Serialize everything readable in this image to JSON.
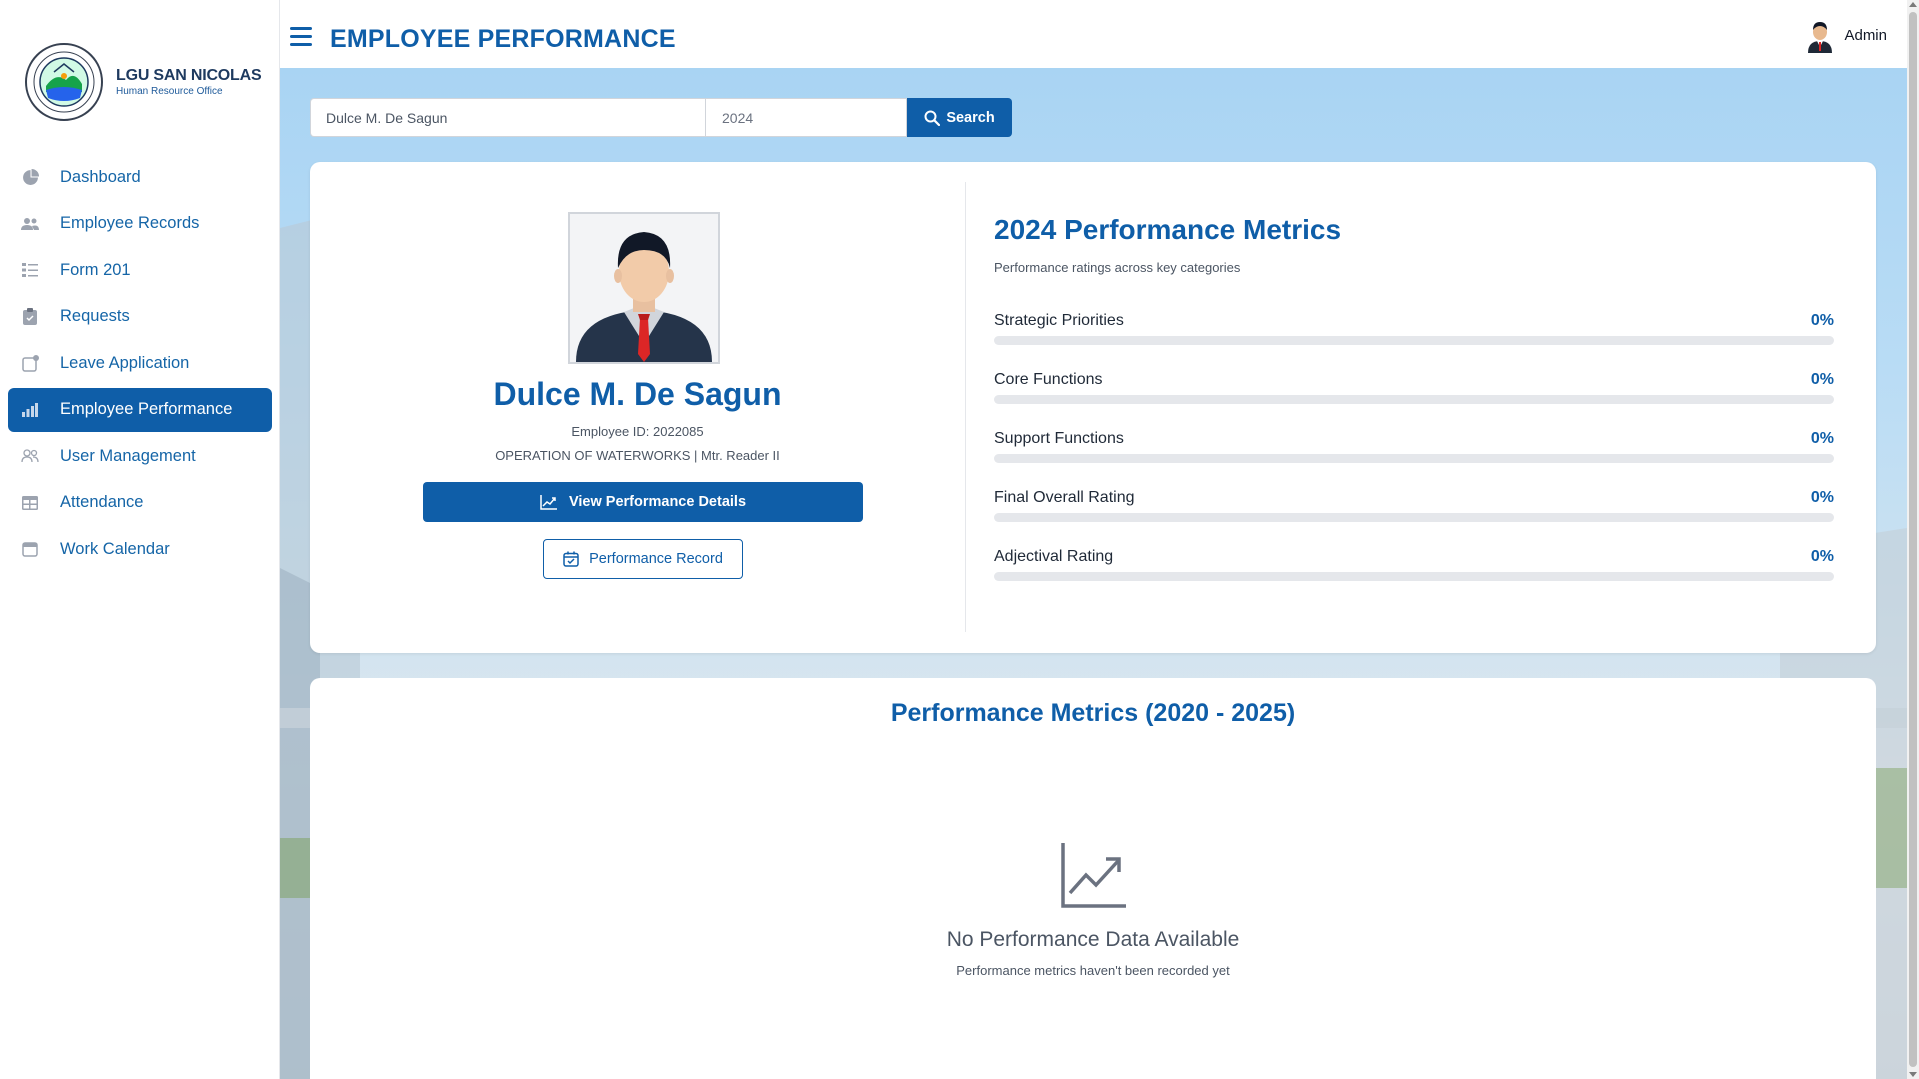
{
  "app": {
    "brand_name": "LGU SAN NICOLAS",
    "brand_sub": "Human Resource Office"
  },
  "sidebar": {
    "items": [
      {
        "label": "Dashboard",
        "icon": "pie-chart-icon",
        "active": false
      },
      {
        "label": "Employee Records",
        "icon": "users-icon",
        "active": false
      },
      {
        "label": "Form 201",
        "icon": "list-icon",
        "active": false
      },
      {
        "label": "Requests",
        "icon": "clipboard-icon",
        "active": false
      },
      {
        "label": "Leave Application",
        "icon": "calendar-notify-icon",
        "active": false
      },
      {
        "label": "Employee Performance",
        "icon": "bar-chart-icon",
        "active": true
      },
      {
        "label": "User Management",
        "icon": "user-group-icon",
        "active": false
      },
      {
        "label": "Attendance",
        "icon": "table-icon",
        "active": false
      },
      {
        "label": "Work Calendar",
        "icon": "calendar-icon",
        "active": false
      }
    ]
  },
  "header": {
    "title": "EMPLOYEE PERFORMANCE",
    "user": "Admin"
  },
  "search": {
    "name_value": "Dulce M. De Sagun",
    "year_value": "2024",
    "button_label": "Search"
  },
  "profile": {
    "name": "Dulce M. De Sagun",
    "employee_id": "Employee ID: 2022085",
    "department": "OPERATION OF WATERWORKS | Mtr. Reader II",
    "details_button": "View Performance Details",
    "record_button": "Performance Record"
  },
  "metrics": {
    "title": "2024 Performance Metrics",
    "subtitle": "Performance ratings across key categories",
    "items": [
      {
        "label": "Strategic Priorities",
        "value": "0%",
        "fill": 0
      },
      {
        "label": "Core Functions",
        "value": "0%",
        "fill": 0
      },
      {
        "label": "Support Functions",
        "value": "0%",
        "fill": 0
      },
      {
        "label": "Final Overall Rating",
        "value": "0%",
        "fill": 0
      },
      {
        "label": "Adjectival Rating",
        "value": "0%",
        "fill": 0
      }
    ]
  },
  "history": {
    "title": "Performance Metrics (2020 - 2025)",
    "empty_title": "No Performance Data Available",
    "empty_subtitle": "Performance metrics haven't been recorded yet"
  },
  "colors": {
    "primary": "#0f5ea8",
    "text": "#1f2937",
    "muted": "#4b5563"
  }
}
